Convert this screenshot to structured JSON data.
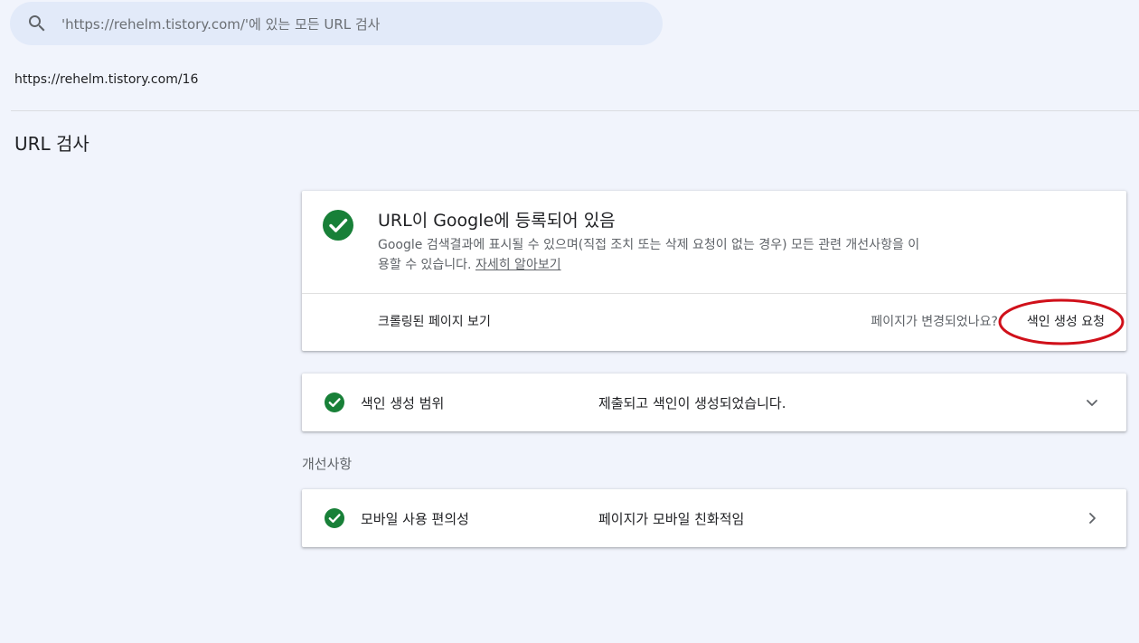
{
  "search": {
    "placeholder": "'https://rehelm.tistory.com/'에 있는 모든 URL 검사",
    "icon": "search-icon"
  },
  "inspected_url": "https://rehelm.tistory.com/16",
  "page_title": "URL 검사",
  "status_card": {
    "icon": "check-circle-icon",
    "title": "URL이 Google에 등록되어 있음",
    "description": "Google 검색결과에 표시될 수 있으며(직접 조치 또는 삭제 요청이 없는 경우) 모든 관련 개선사항을 이용할 수 있습니다.",
    "learn_more": "자세히 알아보기",
    "view_crawled": "크롤링된 페이지 보기",
    "changed_question": "페이지가 변경되었나요?",
    "request_indexing": "색인 생성 요청"
  },
  "coverage": {
    "label": "색인 생성 범위",
    "value": "제출되고 색인이 생성되었습니다.",
    "chevron": "chevron-down-icon"
  },
  "enhancements_label": "개선사항",
  "mobile": {
    "label": "모바일 사용 편의성",
    "value": "페이지가 모바일 친화적임",
    "chevron": "chevron-right-icon"
  },
  "colors": {
    "success_green": "#188038",
    "highlight_red": "#d0101a",
    "background": "#f1f4fc",
    "search_bg": "#e2eaf9"
  }
}
